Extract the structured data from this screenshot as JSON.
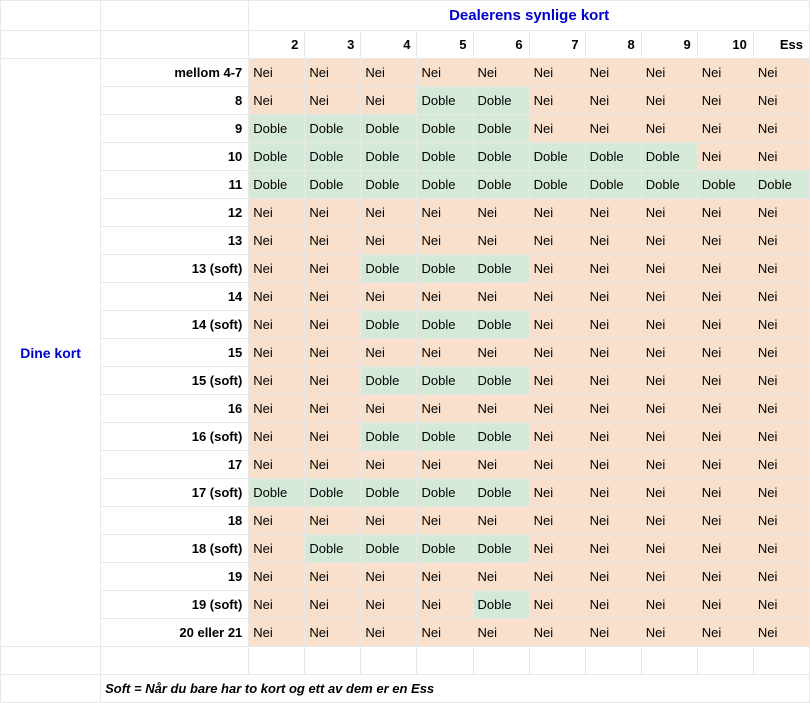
{
  "headers": {
    "dealer_title": "Dealerens synlige kort",
    "player_title": "Dine kort"
  },
  "dealer_cards": [
    "2",
    "3",
    "4",
    "5",
    "6",
    "7",
    "8",
    "9",
    "10",
    "Ess"
  ],
  "rows": [
    {
      "label": "mellom 4-7",
      "cells": [
        "Nei",
        "Nei",
        "Nei",
        "Nei",
        "Nei",
        "Nei",
        "Nei",
        "Nei",
        "Nei",
        "Nei"
      ]
    },
    {
      "label": "8",
      "cells": [
        "Nei",
        "Nei",
        "Nei",
        "Doble",
        "Doble",
        "Nei",
        "Nei",
        "Nei",
        "Nei",
        "Nei"
      ]
    },
    {
      "label": "9",
      "cells": [
        "Doble",
        "Doble",
        "Doble",
        "Doble",
        "Doble",
        "Nei",
        "Nei",
        "Nei",
        "Nei",
        "Nei"
      ]
    },
    {
      "label": "10",
      "cells": [
        "Doble",
        "Doble",
        "Doble",
        "Doble",
        "Doble",
        "Doble",
        "Doble",
        "Doble",
        "Nei",
        "Nei"
      ]
    },
    {
      "label": "11",
      "cells": [
        "Doble",
        "Doble",
        "Doble",
        "Doble",
        "Doble",
        "Doble",
        "Doble",
        "Doble",
        "Doble",
        "Doble"
      ]
    },
    {
      "label": "12",
      "cells": [
        "Nei",
        "Nei",
        "Nei",
        "Nei",
        "Nei",
        "Nei",
        "Nei",
        "Nei",
        "Nei",
        "Nei"
      ]
    },
    {
      "label": "13",
      "cells": [
        "Nei",
        "Nei",
        "Nei",
        "Nei",
        "Nei",
        "Nei",
        "Nei",
        "Nei",
        "Nei",
        "Nei"
      ]
    },
    {
      "label": "13 (soft)",
      "cells": [
        "Nei",
        "Nei",
        "Doble",
        "Doble",
        "Doble",
        "Nei",
        "Nei",
        "Nei",
        "Nei",
        "Nei"
      ]
    },
    {
      "label": "14",
      "cells": [
        "Nei",
        "Nei",
        "Nei",
        "Nei",
        "Nei",
        "Nei",
        "Nei",
        "Nei",
        "Nei",
        "Nei"
      ]
    },
    {
      "label": "14 (soft)",
      "cells": [
        "Nei",
        "Nei",
        "Doble",
        "Doble",
        "Doble",
        "Nei",
        "Nei",
        "Nei",
        "Nei",
        "Nei"
      ]
    },
    {
      "label": "15",
      "cells": [
        "Nei",
        "Nei",
        "Nei",
        "Nei",
        "Nei",
        "Nei",
        "Nei",
        "Nei",
        "Nei",
        "Nei"
      ]
    },
    {
      "label": "15 (soft)",
      "cells": [
        "Nei",
        "Nei",
        "Doble",
        "Doble",
        "Doble",
        "Nei",
        "Nei",
        "Nei",
        "Nei",
        "Nei"
      ]
    },
    {
      "label": "16",
      "cells": [
        "Nei",
        "Nei",
        "Nei",
        "Nei",
        "Nei",
        "Nei",
        "Nei",
        "Nei",
        "Nei",
        "Nei"
      ]
    },
    {
      "label": "16 (soft)",
      "cells": [
        "Nei",
        "Nei",
        "Doble",
        "Doble",
        "Doble",
        "Nei",
        "Nei",
        "Nei",
        "Nei",
        "Nei"
      ]
    },
    {
      "label": "17",
      "cells": [
        "Nei",
        "Nei",
        "Nei",
        "Nei",
        "Nei",
        "Nei",
        "Nei",
        "Nei",
        "Nei",
        "Nei"
      ]
    },
    {
      "label": "17 (soft)",
      "cells": [
        "Doble",
        "Doble",
        "Doble",
        "Doble",
        "Doble",
        "Nei",
        "Nei",
        "Nei",
        "Nei",
        "Nei"
      ]
    },
    {
      "label": "18",
      "cells": [
        "Nei",
        "Nei",
        "Nei",
        "Nei",
        "Nei",
        "Nei",
        "Nei",
        "Nei",
        "Nei",
        "Nei"
      ]
    },
    {
      "label": "18 (soft)",
      "cells": [
        "Nei",
        "Doble",
        "Doble",
        "Doble",
        "Doble",
        "Nei",
        "Nei",
        "Nei",
        "Nei",
        "Nei"
      ]
    },
    {
      "label": "19",
      "cells": [
        "Nei",
        "Nei",
        "Nei",
        "Nei",
        "Nei",
        "Nei",
        "Nei",
        "Nei",
        "Nei",
        "Nei"
      ]
    },
    {
      "label": "19 (soft)",
      "cells": [
        "Nei",
        "Nei",
        "Nei",
        "Nei",
        "Doble",
        "Nei",
        "Nei",
        "Nei",
        "Nei",
        "Nei"
      ]
    },
    {
      "label": "20 eller 21",
      "cells": [
        "Nei",
        "Nei",
        "Nei",
        "Nei",
        "Nei",
        "Nei",
        "Nei",
        "Nei",
        "Nei",
        "Nei"
      ]
    }
  ],
  "footnote": "Soft = Når du bare har to kort og ett av dem er en Ess",
  "colors": {
    "nei_bg": "#f8e0cc",
    "doble_bg": "#d4e9d8"
  },
  "chart_data": {
    "type": "table",
    "title": "Dealerens synlige kort / Dine kort",
    "row_axis": "Dine kort",
    "col_axis": "Dealerens synlige kort",
    "columns": [
      "2",
      "3",
      "4",
      "5",
      "6",
      "7",
      "8",
      "9",
      "10",
      "Ess"
    ],
    "rows": [
      "mellom 4-7",
      "8",
      "9",
      "10",
      "11",
      "12",
      "13",
      "13 (soft)",
      "14",
      "14 (soft)",
      "15",
      "15 (soft)",
      "16",
      "16 (soft)",
      "17",
      "17 (soft)",
      "18",
      "18 (soft)",
      "19",
      "19 (soft)",
      "20 eller 21"
    ],
    "values": [
      [
        "Nei",
        "Nei",
        "Nei",
        "Nei",
        "Nei",
        "Nei",
        "Nei",
        "Nei",
        "Nei",
        "Nei"
      ],
      [
        "Nei",
        "Nei",
        "Nei",
        "Doble",
        "Doble",
        "Nei",
        "Nei",
        "Nei",
        "Nei",
        "Nei"
      ],
      [
        "Doble",
        "Doble",
        "Doble",
        "Doble",
        "Doble",
        "Nei",
        "Nei",
        "Nei",
        "Nei",
        "Nei"
      ],
      [
        "Doble",
        "Doble",
        "Doble",
        "Doble",
        "Doble",
        "Doble",
        "Doble",
        "Doble",
        "Nei",
        "Nei"
      ],
      [
        "Doble",
        "Doble",
        "Doble",
        "Doble",
        "Doble",
        "Doble",
        "Doble",
        "Doble",
        "Doble",
        "Doble"
      ],
      [
        "Nei",
        "Nei",
        "Nei",
        "Nei",
        "Nei",
        "Nei",
        "Nei",
        "Nei",
        "Nei",
        "Nei"
      ],
      [
        "Nei",
        "Nei",
        "Nei",
        "Nei",
        "Nei",
        "Nei",
        "Nei",
        "Nei",
        "Nei",
        "Nei"
      ],
      [
        "Nei",
        "Nei",
        "Doble",
        "Doble",
        "Doble",
        "Nei",
        "Nei",
        "Nei",
        "Nei",
        "Nei"
      ],
      [
        "Nei",
        "Nei",
        "Nei",
        "Nei",
        "Nei",
        "Nei",
        "Nei",
        "Nei",
        "Nei",
        "Nei"
      ],
      [
        "Nei",
        "Nei",
        "Doble",
        "Doble",
        "Doble",
        "Nei",
        "Nei",
        "Nei",
        "Nei",
        "Nei"
      ],
      [
        "Nei",
        "Nei",
        "Nei",
        "Nei",
        "Nei",
        "Nei",
        "Nei",
        "Nei",
        "Nei",
        "Nei"
      ],
      [
        "Nei",
        "Nei",
        "Doble",
        "Doble",
        "Doble",
        "Nei",
        "Nei",
        "Nei",
        "Nei",
        "Nei"
      ],
      [
        "Nei",
        "Nei",
        "Nei",
        "Nei",
        "Nei",
        "Nei",
        "Nei",
        "Nei",
        "Nei",
        "Nei"
      ],
      [
        "Nei",
        "Nei",
        "Doble",
        "Doble",
        "Doble",
        "Nei",
        "Nei",
        "Nei",
        "Nei",
        "Nei"
      ],
      [
        "Nei",
        "Nei",
        "Nei",
        "Nei",
        "Nei",
        "Nei",
        "Nei",
        "Nei",
        "Nei",
        "Nei"
      ],
      [
        "Doble",
        "Doble",
        "Doble",
        "Doble",
        "Doble",
        "Nei",
        "Nei",
        "Nei",
        "Nei",
        "Nei"
      ],
      [
        "Nei",
        "Nei",
        "Nei",
        "Nei",
        "Nei",
        "Nei",
        "Nei",
        "Nei",
        "Nei",
        "Nei"
      ],
      [
        "Nei",
        "Doble",
        "Doble",
        "Doble",
        "Doble",
        "Nei",
        "Nei",
        "Nei",
        "Nei",
        "Nei"
      ],
      [
        "Nei",
        "Nei",
        "Nei",
        "Nei",
        "Nei",
        "Nei",
        "Nei",
        "Nei",
        "Nei",
        "Nei"
      ],
      [
        "Nei",
        "Nei",
        "Nei",
        "Nei",
        "Doble",
        "Nei",
        "Nei",
        "Nei",
        "Nei",
        "Nei"
      ],
      [
        "Nei",
        "Nei",
        "Nei",
        "Nei",
        "Nei",
        "Nei",
        "Nei",
        "Nei",
        "Nei",
        "Nei"
      ]
    ],
    "legend": {
      "Nei": "#f8e0cc",
      "Doble": "#d4e9d8"
    },
    "note": "Soft = Når du bare har to kort og ett av dem er en Ess"
  }
}
